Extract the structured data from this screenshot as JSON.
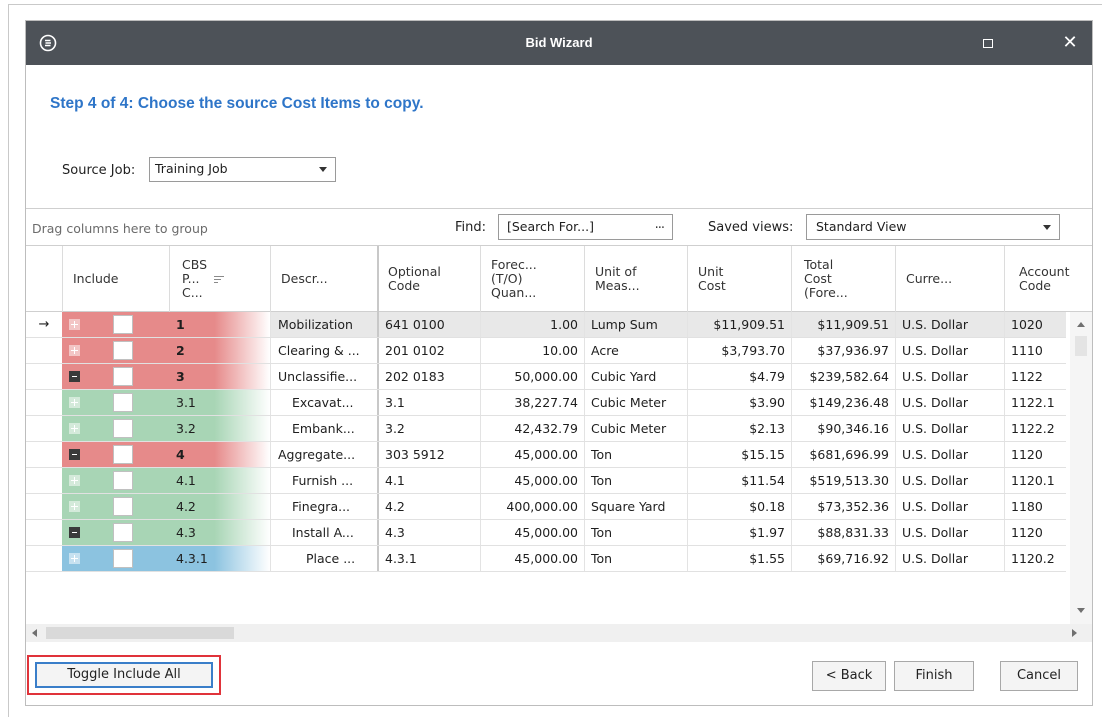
{
  "window": {
    "title": "Bid Wizard",
    "close_glyph": "✕"
  },
  "step_title": "Step 4 of 4: Choose the source Cost Items to copy.",
  "source_job": {
    "label": "Source Job:",
    "value": "Training Job"
  },
  "toolbar": {
    "drag_hint": "Drag columns here to group",
    "find_label": "Find:",
    "find_value": "[Search For...]",
    "find_more": "...",
    "views_label": "Saved views:",
    "views_value": "Standard View"
  },
  "columns": [
    "Include",
    "CBS\nP...\nC...",
    "Descr...",
    "Optional\nCode",
    "Forec...\n(T/O)\nQuan...",
    "Unit of\nMeas...",
    "Unit\nCost",
    "Total\nCost\n(Fore...",
    "Curre...",
    "Account\nCode"
  ],
  "current_row_glyph": "→",
  "rows": [
    {
      "cbs": "1",
      "desc": "Mobilization",
      "code": "641 0100",
      "qty": "1.00",
      "uom": "Lump Sum",
      "unit_cost": "$11,909.51",
      "total": "$11,909.51",
      "currency": "U.S. Dollar",
      "account": "1020",
      "color": "red",
      "expander": "expand",
      "bold": true,
      "indent": 0,
      "current": true
    },
    {
      "cbs": "2",
      "desc": "Clearing & ...",
      "code": "201 0102",
      "qty": "10.00",
      "uom": "Acre",
      "unit_cost": "$3,793.70",
      "total": "$37,936.97",
      "currency": "U.S. Dollar",
      "account": "1110",
      "color": "red",
      "expander": "expand",
      "bold": true,
      "indent": 0
    },
    {
      "cbs": "3",
      "desc": "Unclassifie...",
      "code": "202 0183",
      "qty": "50,000.00",
      "uom": "Cubic Yard",
      "unit_cost": "$4.79",
      "total": "$239,582.64",
      "currency": "U.S. Dollar",
      "account": "1122",
      "color": "red",
      "expander": "collapse",
      "bold": true,
      "indent": 0
    },
    {
      "cbs": "3.1",
      "desc": "Excavat...",
      "code": "3.1",
      "qty": "38,227.74",
      "uom": "Cubic Meter",
      "unit_cost": "$3.90",
      "total": "$149,236.48",
      "currency": "U.S. Dollar",
      "account": "1122.1",
      "color": "green",
      "expander": "expand",
      "bold": false,
      "indent": 1
    },
    {
      "cbs": "3.2",
      "desc": "Embank...",
      "code": "3.2",
      "qty": "42,432.79",
      "uom": "Cubic Meter",
      "unit_cost": "$2.13",
      "total": "$90,346.16",
      "currency": "U.S. Dollar",
      "account": "1122.2",
      "color": "green",
      "expander": "expand",
      "bold": false,
      "indent": 1
    },
    {
      "cbs": "4",
      "desc": "Aggregate...",
      "code": "303 5912",
      "qty": "45,000.00",
      "uom": "Ton",
      "unit_cost": "$15.15",
      "total": "$681,696.99",
      "currency": "U.S. Dollar",
      "account": "1120",
      "color": "red",
      "expander": "collapse",
      "bold": true,
      "indent": 0
    },
    {
      "cbs": "4.1",
      "desc": "Furnish ...",
      "code": "4.1",
      "qty": "45,000.00",
      "uom": "Ton",
      "unit_cost": "$11.54",
      "total": "$519,513.30",
      "currency": "U.S. Dollar",
      "account": "1120.1",
      "color": "green",
      "expander": "expand",
      "bold": false,
      "indent": 1
    },
    {
      "cbs": "4.2",
      "desc": "Finegra...",
      "code": "4.2",
      "qty": "400,000.00",
      "uom": "Square Yard",
      "unit_cost": "$0.18",
      "total": "$73,352.36",
      "currency": "U.S. Dollar",
      "account": "1180",
      "color": "green",
      "expander": "expand",
      "bold": false,
      "indent": 1
    },
    {
      "cbs": "4.3",
      "desc": "Install A...",
      "code": "4.3",
      "qty": "45,000.00",
      "uom": "Ton",
      "unit_cost": "$1.97",
      "total": "$88,831.33",
      "currency": "U.S. Dollar",
      "account": "1120",
      "color": "green",
      "expander": "collapse",
      "bold": false,
      "indent": 1
    },
    {
      "cbs": "4.3.1",
      "desc": "Place ...",
      "code": "4.3.1",
      "qty": "45,000.00",
      "uom": "Ton",
      "unit_cost": "$1.55",
      "total": "$69,716.92",
      "currency": "U.S. Dollar",
      "account": "1120.2",
      "color": "blue",
      "expander": "expand",
      "bold": false,
      "indent": 2
    }
  ],
  "colors": {
    "red": "#e68a8a",
    "green": "#a8d5b5",
    "blue": "#8cc3e0",
    "title_bar": "#4d5258",
    "step_title": "#2e75c8",
    "highlight": "#e0333a"
  },
  "buttons": {
    "toggle_include_all": "Toggle Include All",
    "back": "< Back",
    "finish": "Finish",
    "cancel": "Cancel"
  }
}
